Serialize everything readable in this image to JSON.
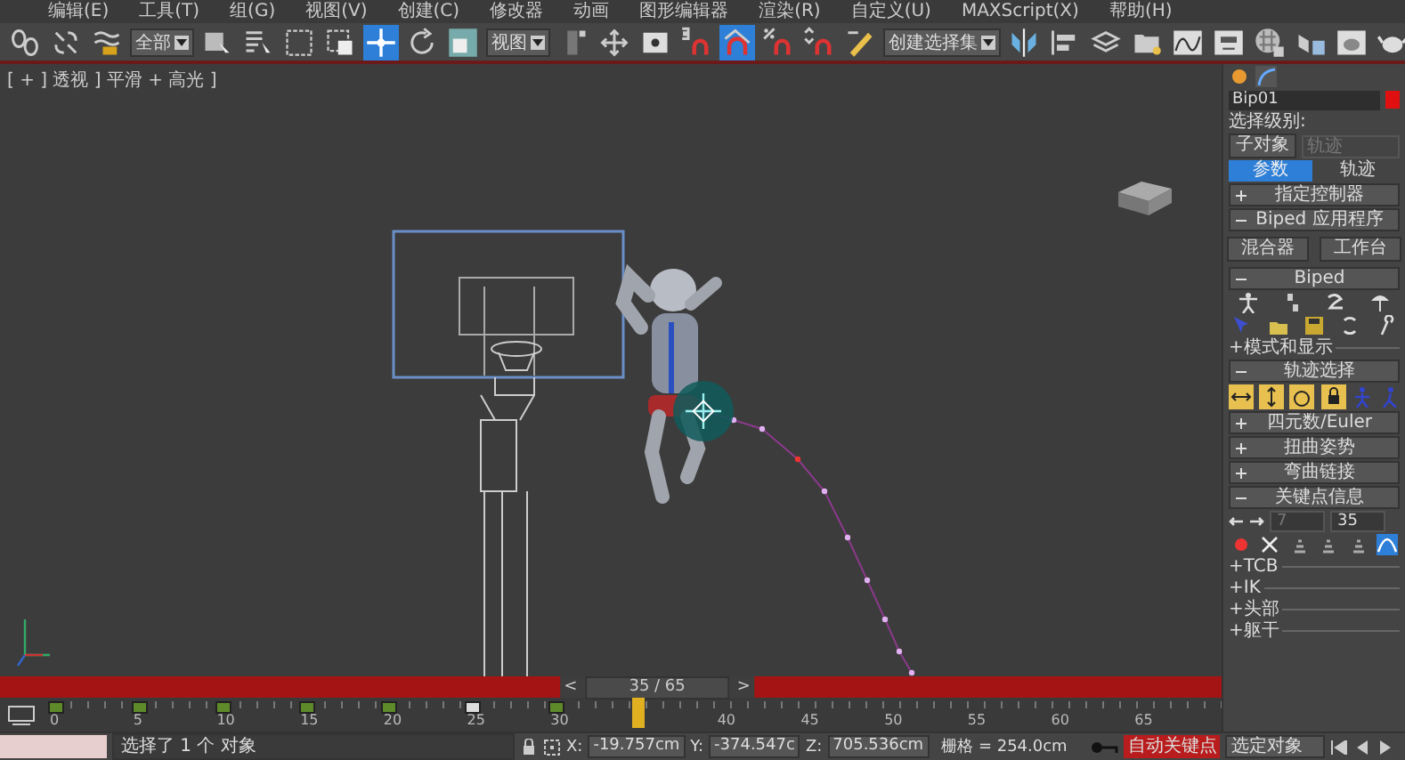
{
  "menu_bar": {
    "items": [
      "编辑(E)",
      "工具(T)",
      "组(G)",
      "视图(V)",
      "创建(C)",
      "修改器",
      "动画",
      "图形编辑器",
      "渲染(R)",
      "自定义(U)",
      "MAXScript(X)",
      "帮助(H)"
    ]
  },
  "toolbar": {
    "items": [
      {
        "kind": "button",
        "selected": false
      },
      {
        "kind": "button",
        "selected": false
      },
      {
        "kind": "button",
        "selected": false
      },
      {
        "kind": "dropdown",
        "value": "全部"
      },
      {
        "kind": "button",
        "selected": false
      },
      {
        "kind": "button",
        "selected": false
      },
      {
        "kind": "button",
        "selected": false
      },
      {
        "kind": "button",
        "selected": false
      },
      {
        "kind": "button",
        "selected": true
      },
      {
        "kind": "button",
        "selected": false
      },
      {
        "kind": "button",
        "selected": false
      },
      {
        "kind": "dropdown",
        "value": "视图"
      },
      {
        "kind": "button",
        "selected": false
      },
      {
        "kind": "button",
        "selected": false
      },
      {
        "kind": "button",
        "selected": false
      },
      {
        "kind": "button",
        "selected": false
      },
      {
        "kind": "button",
        "selected": true
      },
      {
        "kind": "button",
        "selected": false
      },
      {
        "kind": "button",
        "selected": false
      },
      {
        "kind": "button",
        "selected": false
      },
      {
        "kind": "dropdown",
        "value": "创建选择集"
      },
      {
        "kind": "button",
        "selected": false
      },
      {
        "kind": "button",
        "selected": false
      },
      {
        "kind": "button",
        "selected": false
      },
      {
        "kind": "button",
        "selected": false
      },
      {
        "kind": "button",
        "selected": false
      },
      {
        "kind": "button",
        "selected": false
      },
      {
        "kind": "button",
        "selected": false
      },
      {
        "kind": "button",
        "selected": false
      },
      {
        "kind": "button",
        "selected": false
      },
      {
        "kind": "button",
        "selected": false
      }
    ]
  },
  "viewport": {
    "label": "[ + ] 透视 ] 平滑 + 高光 ]"
  },
  "command_panel": {
    "object_name": "Bip01",
    "selection_level_label": "选择级别:",
    "sub_object_button": "子对象",
    "sub_object_dropdown": {
      "value": "轨迹",
      "disabled": true
    },
    "tabs": [
      {
        "label": "参数",
        "selected": true
      },
      {
        "label": "轨迹",
        "selected": false
      }
    ],
    "rollouts": [
      {
        "title": "指定控制器",
        "expanded": false
      },
      {
        "kind": "buttons",
        "title": "Biped 应用程序",
        "expanded": true,
        "buttons": [
          "混合器",
          "工作台"
        ]
      },
      {
        "kind": "biped",
        "title": "Biped",
        "expanded": true,
        "subrollouts": [
          "+模式和显示"
        ]
      },
      {
        "kind": "track-selection",
        "title": "轨迹选择",
        "expanded": true
      },
      {
        "title": "四元数/Euler",
        "expanded": false
      },
      {
        "title": "扭曲姿势",
        "expanded": false
      },
      {
        "title": "弯曲链接",
        "expanded": false
      },
      {
        "kind": "key-info",
        "title": "关键点信息",
        "expanded": true,
        "key_number": "7",
        "time_value": "35",
        "key_buttons": [
          {
            "selected": false
          },
          {
            "selected": false
          },
          {
            "selected": false
          },
          {
            "selected": false
          },
          {
            "selected": false
          },
          {
            "selected": true
          }
        ],
        "subrollouts": [
          "+TCB",
          "+IK",
          "+头部",
          "+躯干"
        ]
      }
    ]
  },
  "time_slider": {
    "previous": "<",
    "label": "35 / 65",
    "next": ">",
    "level": 0.538
  },
  "track_bar": {
    "ticks": [
      {
        "label": "0",
        "kind": "key",
        "selected": false
      },
      {
        "label": "5",
        "kind": "key",
        "selected": false
      },
      {
        "label": "10",
        "kind": "key",
        "selected": false
      },
      {
        "label": "15",
        "kind": "key",
        "selected": false
      },
      {
        "label": "20",
        "kind": "key",
        "selected": false
      },
      {
        "label": "25",
        "kind": "empty-key",
        "selected": false
      },
      {
        "label": "30",
        "kind": "key",
        "selected": false
      },
      {
        "selected": true
      },
      {
        "label": "40",
        "kind": "none",
        "selected": false
      },
      {
        "label": "45",
        "kind": "none",
        "selected": false
      },
      {
        "label": "50",
        "kind": "none",
        "selected": false
      },
      {
        "label": "55",
        "kind": "none",
        "selected": false
      },
      {
        "label": "60",
        "kind": "none",
        "selected": false
      },
      {
        "label": "65",
        "kind": "none",
        "selected": false
      }
    ]
  },
  "status_bar": {
    "message": "选择了 1 个 对象",
    "x_label": "X:",
    "x": "-19.757cm",
    "y_label": "Y:",
    "y": "-374.547c",
    "z_label": "Z:",
    "z": "705.536cm",
    "grid": "栅格 = 254.0cm",
    "auto_key": {
      "label": "自动关键点",
      "on": true
    },
    "key_filter": "选定对象"
  }
}
